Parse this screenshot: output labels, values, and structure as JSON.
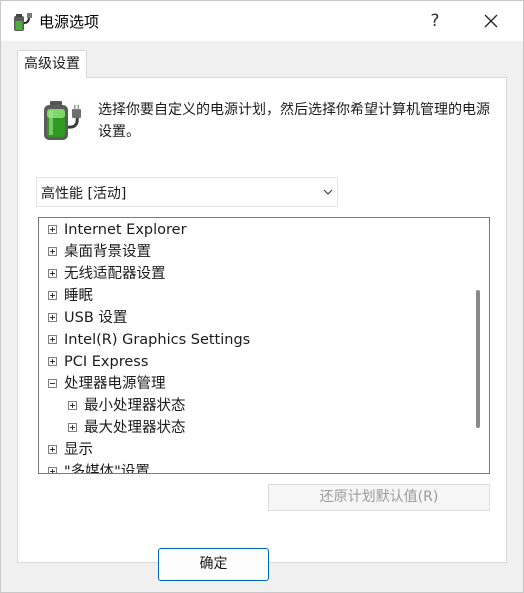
{
  "window": {
    "title": "电源选项",
    "help_label": "?"
  },
  "tabs": [
    {
      "label": "高级设置"
    }
  ],
  "description": "选择你要自定义的电源计划，然后选择你希望计算机管理的电源设置。",
  "plan_select": {
    "value": "高性能 [活动]"
  },
  "tree": [
    {
      "label": "Internet Explorer",
      "expander": "plus",
      "level": 0
    },
    {
      "label": "桌面背景设置",
      "expander": "plus",
      "level": 0
    },
    {
      "label": "无线适配器设置",
      "expander": "plus",
      "level": 0
    },
    {
      "label": "睡眠",
      "expander": "plus",
      "level": 0
    },
    {
      "label": "USB 设置",
      "expander": "plus",
      "level": 0
    },
    {
      "label": "Intel(R) Graphics Settings",
      "expander": "plus",
      "level": 0
    },
    {
      "label": "PCI Express",
      "expander": "plus",
      "level": 0
    },
    {
      "label": "处理器电源管理",
      "expander": "minus",
      "level": 0
    },
    {
      "label": "最小处理器状态",
      "expander": "plus",
      "level": 1
    },
    {
      "label": "最大处理器状态",
      "expander": "plus",
      "level": 1
    },
    {
      "label": "显示",
      "expander": "plus",
      "level": 0
    },
    {
      "label": "\"多媒体\"设置",
      "expander": "plus",
      "level": 0
    }
  ],
  "buttons": {
    "restore_defaults": "还原计划默认值(R)",
    "ok": "确定"
  },
  "colors": {
    "accent": "#0067c0",
    "battery_green": "#3fae29"
  }
}
